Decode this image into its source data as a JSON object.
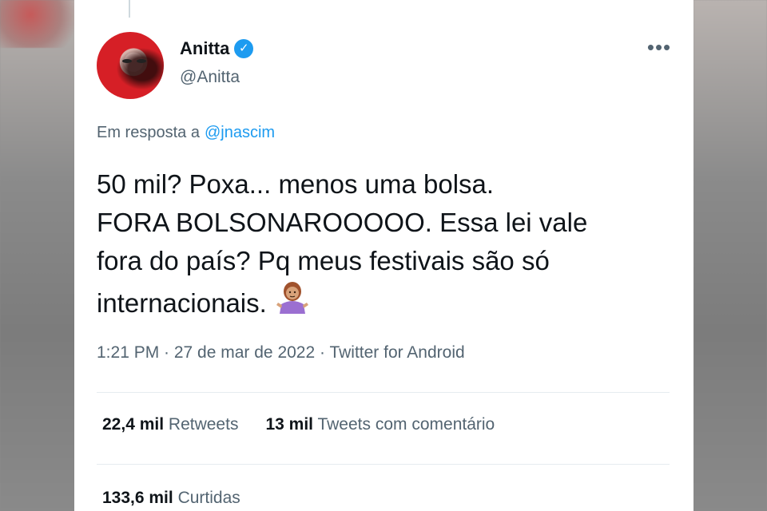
{
  "author": {
    "name": "Anitta",
    "handle": "@Anitta",
    "verified_icon": "verified-check-icon"
  },
  "reply": {
    "prefix": "Em resposta a",
    "mention": "@jnascim"
  },
  "tweet": {
    "lines": [
      "50 mil? Poxa... menos uma bolsa.",
      "FORA BOLSONAROOOOO. Essa lei vale",
      "fora do país? Pq meus festivais são só",
      "internacionais."
    ],
    "emoji": "person-shrugging-emoji"
  },
  "meta": {
    "text": "1:21 PM · 27 de mar de 2022 · Twitter for Android"
  },
  "stats": {
    "retweets_count": "22,4 mil",
    "retweets_label": "Retweets",
    "quotes_count": "13 mil",
    "quotes_label": "Tweets com comentário",
    "likes_count": "133,6 mil",
    "likes_label": "Curtidas"
  },
  "colors": {
    "accent": "#1d9bf0",
    "text_primary": "#0f1419",
    "text_secondary": "#536471"
  },
  "icons": {
    "more": "more-options-icon"
  }
}
